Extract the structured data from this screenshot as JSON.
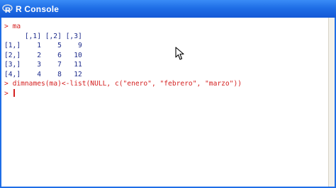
{
  "window": {
    "title": "R Console"
  },
  "console": {
    "lines": [
      {
        "kind": "input",
        "prompt": ">",
        "text": "ma"
      },
      {
        "kind": "output",
        "text": "     [,1] [,2] [,3]"
      },
      {
        "kind": "output",
        "text": "[1,]    1    5    9"
      },
      {
        "kind": "output",
        "text": "[2,]    2    6   10"
      },
      {
        "kind": "output",
        "text": "[3,]    3    7   11"
      },
      {
        "kind": "output",
        "text": "[4,]    4    8   12"
      },
      {
        "kind": "input",
        "prompt": ">",
        "text": "dimnames(ma)<-list(NULL, c(\"enero\", \"febrero\", \"marzo\"))"
      }
    ],
    "current_prompt": ">"
  },
  "colors": {
    "titlebar": "#1f6ee6",
    "input_text": "#d42020",
    "output_text": "#1c2a8a"
  },
  "icons": {
    "app": "r-logo-icon",
    "pointer": "mouse-pointer-icon"
  }
}
